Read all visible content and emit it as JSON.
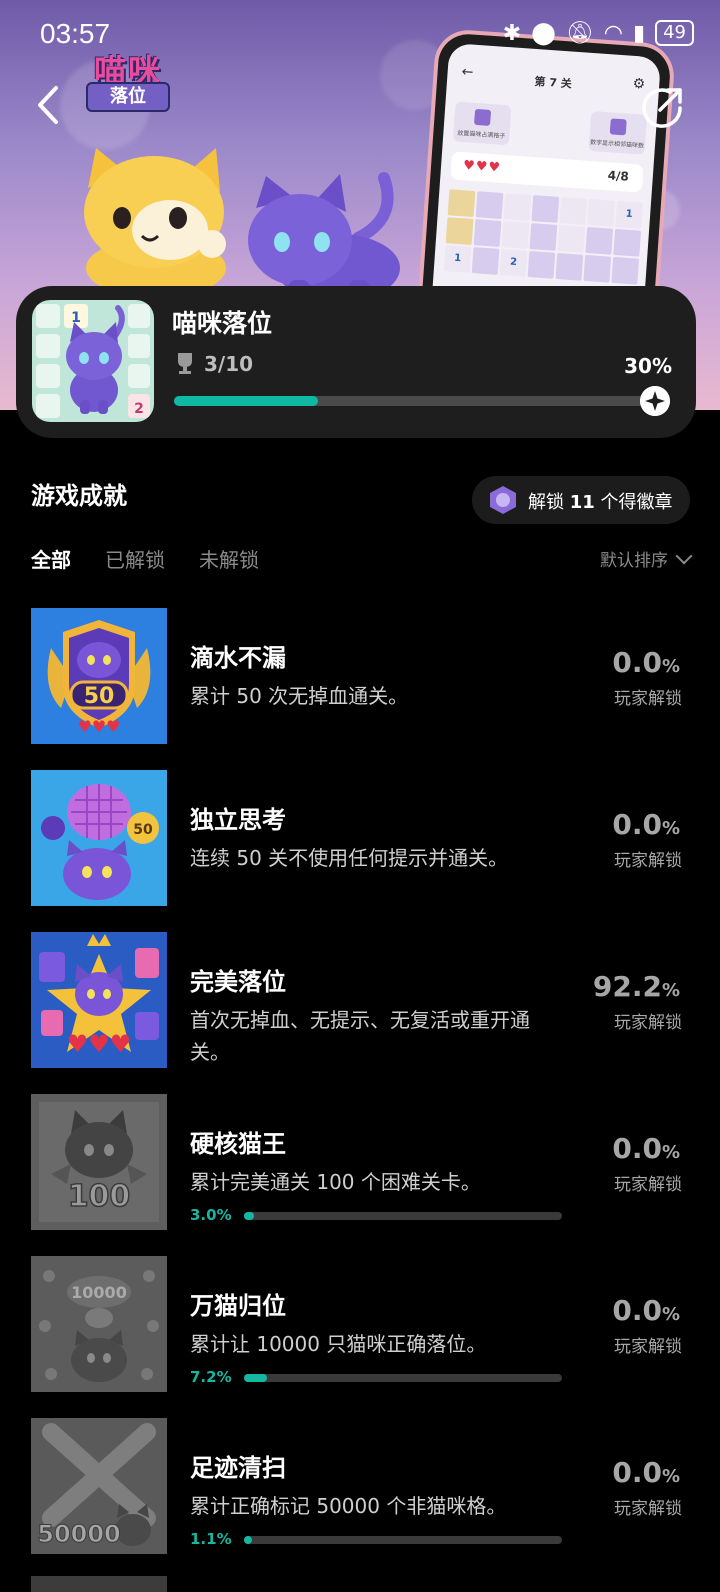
{
  "status_bar": {
    "time": "03:57",
    "battery": "49"
  },
  "hero": {
    "logo_line1": "喵咪",
    "logo_line2": "落位",
    "phone_level": "第 7 关",
    "phone_hint1": "放置猫咪占满格子",
    "phone_hint2": "数字显示相邻猫咪数",
    "phone_hearts": "♥♥♥",
    "phone_count": "4/8"
  },
  "game": {
    "name": "喵咪落位",
    "trophies": "3/10",
    "progress_label": "30%",
    "progress": 0.3
  },
  "achievements_section": {
    "title": "游戏成就",
    "badge_prefix": "解锁",
    "badge_count": "11",
    "badge_suffix": "个得徽章"
  },
  "tabs": [
    {
      "label": "全部",
      "active": true
    },
    {
      "label": "已解锁",
      "active": false
    },
    {
      "label": "未解锁",
      "active": false
    }
  ],
  "sort_label": "默认排序",
  "achievements": [
    {
      "title": "滴水不漏",
      "desc": "累计 50 次无掉血通关。",
      "pct": "0.0",
      "unlock_label": "玩家解锁",
      "icon": "cat-shield-50-icon",
      "locked": false,
      "progress": null
    },
    {
      "title": "独立思考",
      "desc": "连续 50 关不使用任何提示并通关。",
      "pct": "0.0",
      "unlock_label": "玩家解锁",
      "icon": "cat-brain-50-icon",
      "locked": false,
      "progress": null
    },
    {
      "title": "完美落位",
      "desc": "首次无掉血、无提示、无复活或重开通关。",
      "pct": "92.2",
      "unlock_label": "玩家解锁",
      "icon": "cat-star-crown-icon",
      "locked": false,
      "progress": null
    },
    {
      "title": "硬核猫王",
      "desc": "累计完美通关 100 个困难关卡。",
      "pct": "0.0",
      "unlock_label": "玩家解锁",
      "icon": "cat-100-locked-icon",
      "locked": true,
      "progress": {
        "label": "3.0%",
        "value": 0.03
      }
    },
    {
      "title": "万猫归位",
      "desc": "累计让 10000 只猫咪正确落位。",
      "pct": "0.0",
      "unlock_label": "玩家解锁",
      "icon": "cat-10000-locked-icon",
      "locked": true,
      "progress": {
        "label": "7.2%",
        "value": 0.072
      }
    },
    {
      "title": "足迹清扫",
      "desc": "累计正确标记 50000 个非猫咪格。",
      "pct": "0.0",
      "unlock_label": "玩家解锁",
      "icon": "cat-50000-locked-icon",
      "locked": true,
      "progress": {
        "label": "1.1%",
        "value": 0.011
      }
    }
  ],
  "colors": {
    "accent": "#0fb9a4",
    "card_bg": "#1e1e1e",
    "muted": "#8a8a8a"
  }
}
